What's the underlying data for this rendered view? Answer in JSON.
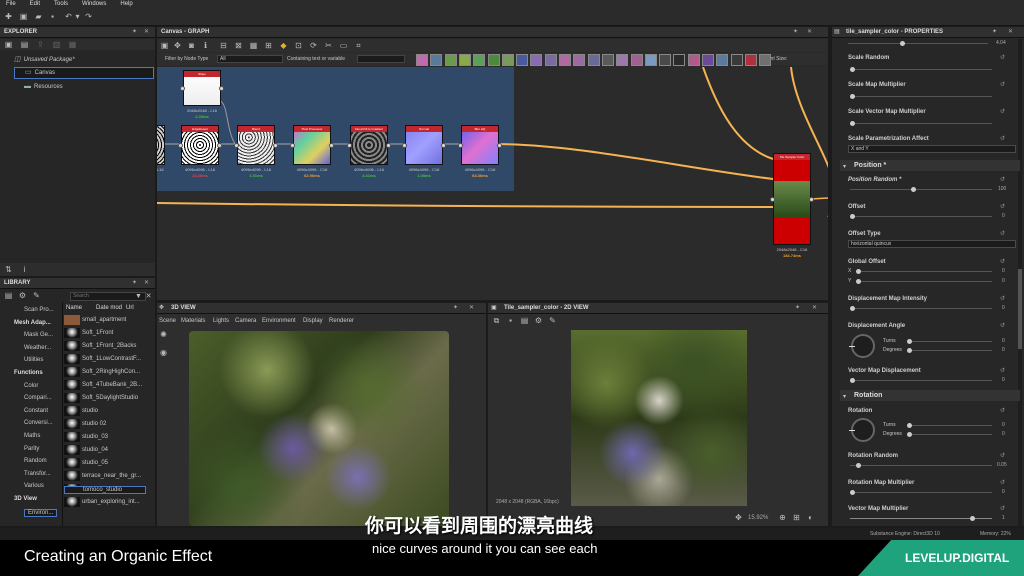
{
  "menu": [
    "File",
    "Edit",
    "Tools",
    "Windows",
    "Help"
  ],
  "explorer": {
    "title": "EXPLORER",
    "package": "Unsaved Package*",
    "items": [
      "Canvas",
      "Resources"
    ]
  },
  "library": {
    "title": "LIBRARY",
    "search_placeholder": "Search",
    "col_name": "Name",
    "col_date": "Date mod",
    "col_url": "Url",
    "categories": [
      "Scan Pro...",
      "Mesh Adap...",
      "Mask Ge...",
      "Weather...",
      "Utilities",
      "Functions",
      "Color",
      "Compari...",
      "Constant",
      "Conversi...",
      "Maths",
      "Parity",
      "Random",
      "Transfor...",
      "Various",
      "3D View",
      "Environ..."
    ],
    "items": [
      "small_apartment",
      "Soft_1Front",
      "Soft_1Front_2Backs",
      "Soft_1LowContrastF...",
      "Soft_2RingHighCon...",
      "Soft_4TubeBank_2B...",
      "Soft_5DaylightStudio",
      "studio",
      "studio 02",
      "studio_03",
      "studio_04",
      "studio_05",
      "terrace_near_the_gr...",
      "tomoco_studio",
      "urban_exploring_int..."
    ]
  },
  "graph": {
    "title": "Canvas - GRAPH",
    "filter_label": "Filter by Node Type",
    "filter_value": "All",
    "contains_label": "Containing text or variable",
    "parent_size": "Parent Size:",
    "nodes": [
      {
        "name": "Slope",
        "res": "2048x2048 - L16",
        "time": "2.00ms"
      },
      {
        "name": "EdgeDetect",
        "res": "4096x4096 - L16",
        "time": "23.88ms"
      },
      {
        "name": "Blend",
        "res": "4096x4096 - L16",
        "time": "1.51ms"
      },
      {
        "name": "Pixel Processor",
        "res": "4096x4096 - C16",
        "time": "62.96ms"
      },
      {
        "name": "Flood Fill to Gradient",
        "res": "4096x4096 - L16",
        "time": "4.41ms"
      },
      {
        "name": "Normal",
        "res": "4096x4096 - C16",
        "time": "1.08ms"
      },
      {
        "name": "Blur HQ",
        "res": "4096x4096 - C16",
        "time": "64.36ms"
      },
      {
        "name": "Tile Sampler Color",
        "res": "2048x2048 - C16",
        "time": "184.74ms"
      }
    ],
    "left_node_res": "- L16"
  },
  "view3d": {
    "title": "3D VIEW",
    "menu": [
      "Scene",
      "Materials",
      "Lights",
      "Camera",
      "Environment",
      "Display",
      "Renderer"
    ]
  },
  "view2d": {
    "title": "Tile_sampler_color - 2D VIEW",
    "status": "2048 x 2048 (RGBA, 16bpc)",
    "zoom": "15.92%"
  },
  "properties": {
    "title": "tile_sampler_color - PROPERTIES",
    "top_value": "4.04",
    "scale_random": "Scale Random",
    "scale_map_mult": "Scale Map Multiplier",
    "scale_vec_map_mult": "Scale Vector Map Multiplier",
    "scale_param": "Scale Parametrization Affect",
    "scale_param_value": "X and Y",
    "section_position": "Position *",
    "position_random": "Position Random *",
    "position_random_value": "100",
    "offset": "Offset",
    "offset_value": "0",
    "offset_type": "Offset Type",
    "offset_type_value": "horizontal quincux",
    "global_offset": "Global Offset",
    "x_label": "X",
    "y_label": "Y",
    "x_value": "0",
    "y_value": "0",
    "disp_intensity": "Displacement Map Intensity",
    "disp_intensity_value": "0",
    "disp_angle": "Displacement Angle",
    "turns": "Turns",
    "degrees": "Degrees",
    "turns_value": "0",
    "degrees_value": "0",
    "vec_map_disp": "Vector Map Displacement",
    "vec_map_disp_value": "0",
    "section_rotation": "Rotation",
    "rotation": "Rotation",
    "rotation_random": "Rotation Random",
    "rotation_random_value": "0.05",
    "rotation_map_mult": "Rotation Map Multiplier",
    "rotation_map_mult_value": "0",
    "vector_map_mult": "Vector Map Multiplier",
    "vector_map_mult_value": "1"
  },
  "statusbar": {
    "engine": "Substance Engine: Direct3D 10",
    "memory": "Memory: 22%"
  },
  "caption": {
    "title": "Creating an Organic Effect",
    "subtitle_cn": "你可以看到周围的漂亮曲线",
    "subtitle_en": "nice curves around it you can see each",
    "brand": "LEVELUP.DIGITAL"
  },
  "colors": {
    "accent": "#f5b352",
    "node_red": "#c4262d",
    "frame_blue": "#314b6d",
    "brand_green": "#1fa37d"
  }
}
